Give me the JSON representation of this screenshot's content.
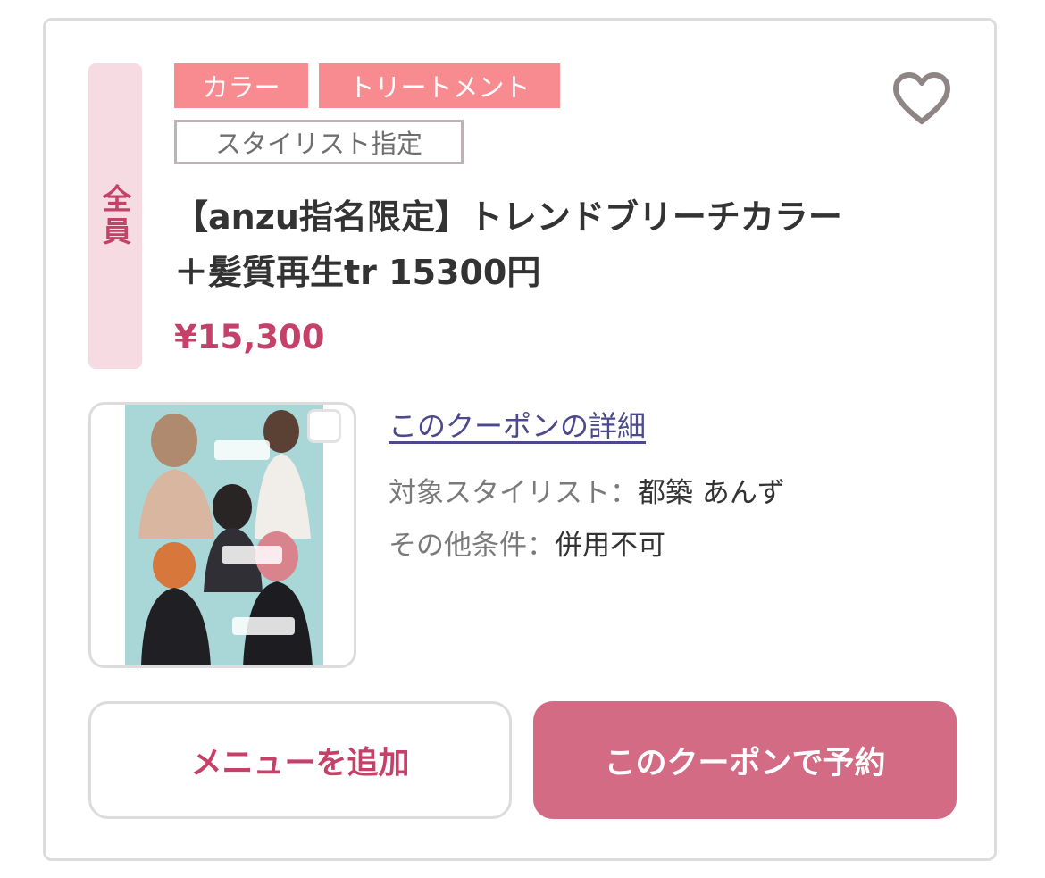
{
  "coupon": {
    "target": "全員",
    "tags": [
      "カラー",
      "トリートメント"
    ],
    "stylist_tag": "スタイリスト指定",
    "title": "【anzu指名限定】トレンドブリーチカラー＋髪質再生tr 15300円",
    "price": "¥15,300",
    "detail_link": "このクーポンの詳細",
    "conditions": [
      {
        "label": "対象スタイリスト：",
        "value": "都築 あんず"
      },
      {
        "label": "その他条件：",
        "value": "併用不可"
      }
    ]
  },
  "actions": {
    "add_menu": "メニューを追加",
    "reserve": "このクーポンで予約"
  },
  "colors": {
    "accent": "#c5416a",
    "tag_pink": "#f78b8f",
    "reserve_button": "#d46b84",
    "badge_bg": "#f6dbe2"
  },
  "icons": [
    "heart-icon"
  ]
}
